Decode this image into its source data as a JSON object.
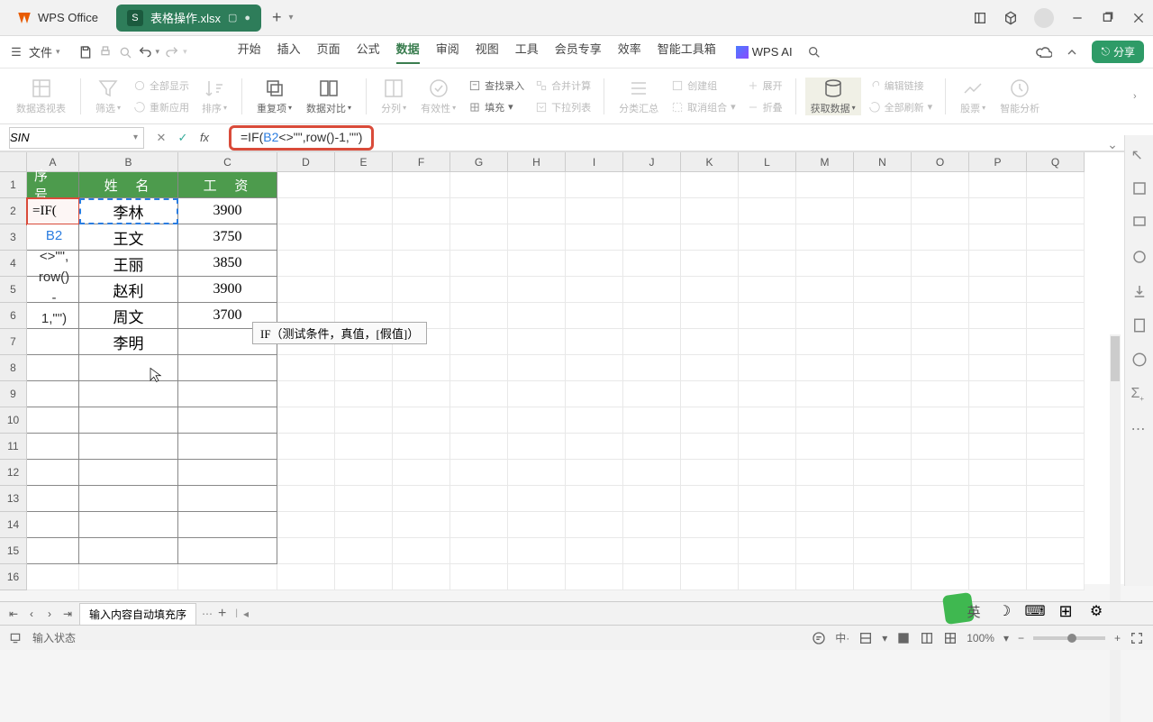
{
  "app": {
    "name": "WPS Office"
  },
  "tab": {
    "icon": "S",
    "filename": "表格操作.xlsx"
  },
  "menu": {
    "file": "文件",
    "tabs": [
      "开始",
      "插入",
      "页面",
      "公式",
      "数据",
      "审阅",
      "视图",
      "工具",
      "会员专享",
      "效率",
      "智能工具箱"
    ],
    "active_index": 4,
    "wps_ai": "WPS AI",
    "share": "分享"
  },
  "ribbon": {
    "pivot": "数据透视表",
    "filter": "筛选",
    "show_all": "全部显示",
    "reapply": "重新应用",
    "sort": "排序",
    "dup": "重复项",
    "compare": "数据对比",
    "split": "分列",
    "validity": "有效性",
    "fill": "填充",
    "find_entry": "查找录入",
    "merge_calc": "合并计算",
    "dropdown_list": "下拉列表",
    "subtotal": "分类汇总",
    "group": "创建组",
    "ungroup": "取消组合",
    "expand": "展开",
    "collapse": "折叠",
    "get_data": "获取数据",
    "edit_link": "编辑链接",
    "refresh_all": "全部刷新",
    "stocks": "股票",
    "smart": "智能分析"
  },
  "formula_bar": {
    "name_box": "SIN",
    "has_cancel": true,
    "has_confirm": true,
    "formula_prefix": "=IF(",
    "formula_ref": "B2",
    "formula_suffix": "<>\"\",row()-1,\"\")"
  },
  "tooltip": {
    "text": "IF（测试条件，真值，[假值]）"
  },
  "columns": [
    "A",
    "B",
    "C",
    "D",
    "E",
    "F",
    "G",
    "H",
    "I",
    "J",
    "K",
    "L",
    "M",
    "N",
    "O",
    "P",
    "Q"
  ],
  "col_widths": {
    "A": 58,
    "B": 110,
    "C": 110,
    "rest": 64
  },
  "row_count": 16,
  "headers": {
    "A": "序 号",
    "B": "姓 名",
    "C": "工 资"
  },
  "rows": [
    {
      "B": "李林",
      "C": "3900"
    },
    {
      "B": "王文",
      "C": "3750"
    },
    {
      "B": "王丽",
      "C": "3850"
    },
    {
      "B": "赵利",
      "C": "3900"
    },
    {
      "B": "周文",
      "C": "3700"
    },
    {
      "B": "李明",
      "C": ""
    }
  ],
  "editing_cell": {
    "ref": "A2",
    "display": "=IF(",
    "overflow": [
      "B2",
      "<>\"\",",
      "row()",
      "-",
      "1,\"\")"
    ]
  },
  "sheets": {
    "active": "输入内容自动填充序"
  },
  "status": {
    "mode": "输入状态",
    "ime": "英",
    "zoom": "100%"
  }
}
